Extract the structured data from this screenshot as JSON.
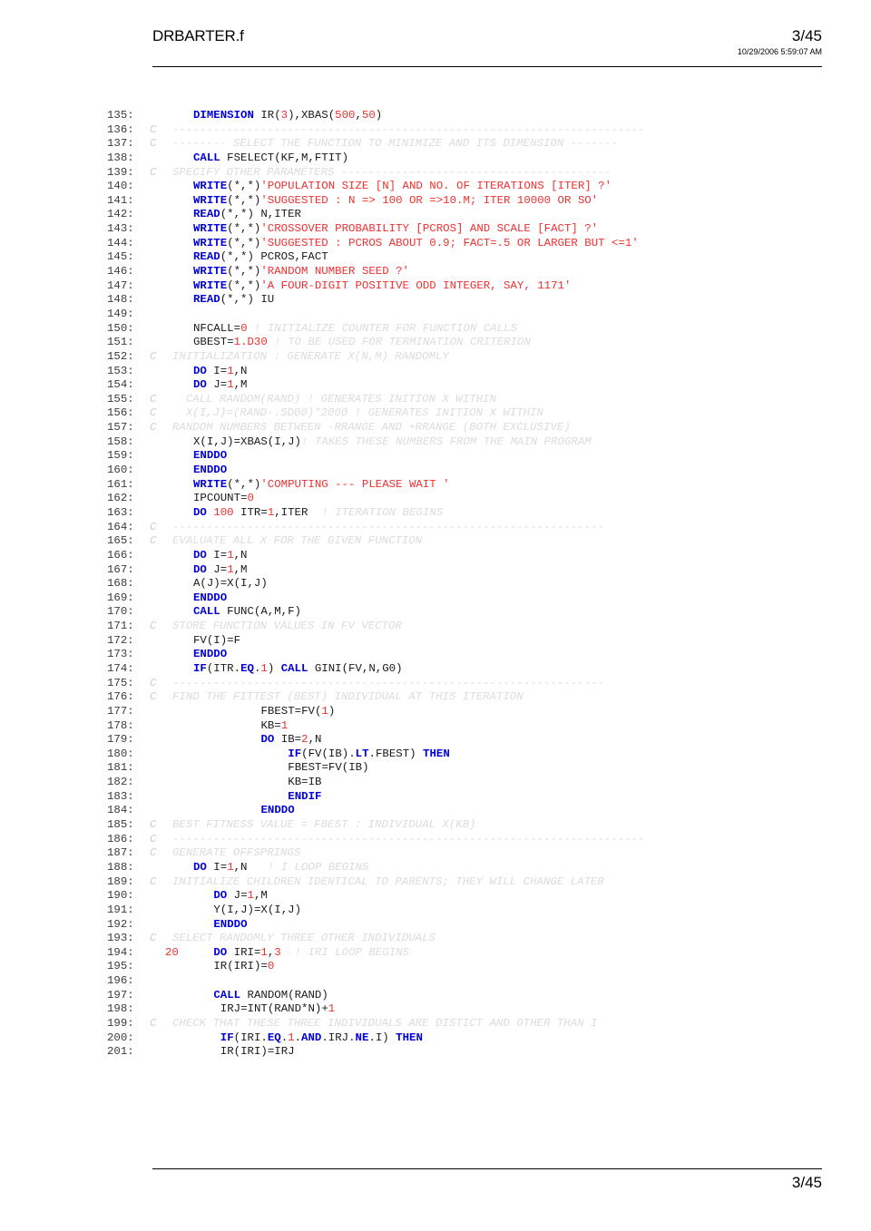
{
  "header": {
    "title": "DRBARTER.f",
    "page_number": "3/45",
    "timestamp": "10/29/2006 5:59:07 AM"
  },
  "footer": {
    "page_number": "3/45"
  },
  "listing": {
    "first_line": 135,
    "last_line": 201,
    "language": "Fortran",
    "lines": [
      {
        "n": "135:",
        "c": "",
        "indent": 0,
        "tokens": [
          {
            "t": "DIMENSION",
            "k": "kw"
          },
          {
            "t": " IR(",
            "k": "plain"
          },
          {
            "t": "3",
            "k": "num"
          },
          {
            "t": "),XBAS(",
            "k": "plain"
          },
          {
            "t": "500",
            "k": "num"
          },
          {
            "t": ",",
            "k": "plain"
          },
          {
            "t": "50",
            "k": "num"
          },
          {
            "t": ")",
            "k": "plain"
          }
        ]
      },
      {
        "n": "136:",
        "c": "C",
        "comment": true,
        "text": "----------------------------------------------------------------------"
      },
      {
        "n": "137:",
        "c": "C",
        "comment": true,
        "text": "-------- SELECT THE FUNCTION TO MINIMIZE AND ITS DIMENSION -------"
      },
      {
        "n": "138:",
        "c": "",
        "tokens": [
          {
            "t": "CALL",
            "k": "kw"
          },
          {
            "t": " FSELECT(KF,M,FTIT)",
            "k": "plain"
          }
        ]
      },
      {
        "n": "139:",
        "c": "C",
        "comment": true,
        "text": "SPECIFY OTHER PARAMETERS ----------------------------------------"
      },
      {
        "n": "140:",
        "c": "",
        "tokens": [
          {
            "t": "WRITE",
            "k": "kw"
          },
          {
            "t": "(*,*)",
            "k": "plain"
          },
          {
            "t": "'POPULATION SIZE [N] AND NO. OF ITERATIONS [ITER] ?'",
            "k": "str"
          }
        ]
      },
      {
        "n": "141:",
        "c": "",
        "tokens": [
          {
            "t": "WRITE",
            "k": "kw"
          },
          {
            "t": "(*,*)",
            "k": "plain"
          },
          {
            "t": "'SUGGESTED : N => 100 OR =>10.M; ITER 10000 OR SO'",
            "k": "str"
          }
        ]
      },
      {
        "n": "142:",
        "c": "",
        "tokens": [
          {
            "t": "READ",
            "k": "kw"
          },
          {
            "t": "(*,*) N,ITER",
            "k": "plain"
          }
        ]
      },
      {
        "n": "143:",
        "c": "",
        "tokens": [
          {
            "t": "WRITE",
            "k": "kw"
          },
          {
            "t": "(*,*)",
            "k": "plain"
          },
          {
            "t": "'CROSSOVER PROBABILITY [PCROS] AND SCALE [FACT] ?'",
            "k": "str"
          }
        ]
      },
      {
        "n": "144:",
        "c": "",
        "tokens": [
          {
            "t": "WRITE",
            "k": "kw"
          },
          {
            "t": "(*,*)",
            "k": "plain"
          },
          {
            "t": "'SUGGESTED : PCROS ABOUT 0.9; FACT=.5 OR LARGER BUT <=1'",
            "k": "str"
          }
        ]
      },
      {
        "n": "145:",
        "c": "",
        "tokens": [
          {
            "t": "READ",
            "k": "kw"
          },
          {
            "t": "(*,*) PCROS,FACT",
            "k": "plain"
          }
        ]
      },
      {
        "n": "146:",
        "c": "",
        "tokens": [
          {
            "t": "WRITE",
            "k": "kw"
          },
          {
            "t": "(*,*)",
            "k": "plain"
          },
          {
            "t": "'RANDOM NUMBER SEED ?'",
            "k": "str"
          }
        ]
      },
      {
        "n": "147:",
        "c": "",
        "tokens": [
          {
            "t": "WRITE",
            "k": "kw"
          },
          {
            "t": "(*,*)",
            "k": "plain"
          },
          {
            "t": "'A FOUR-DIGIT POSITIVE ODD INTEGER, SAY, 1171'",
            "k": "str"
          }
        ]
      },
      {
        "n": "148:",
        "c": "",
        "tokens": [
          {
            "t": "READ",
            "k": "kw"
          },
          {
            "t": "(*,*) IU",
            "k": "plain"
          }
        ]
      },
      {
        "n": "149:",
        "c": "",
        "tokens": []
      },
      {
        "n": "150:",
        "c": "",
        "tokens": [
          {
            "t": "NFCALL=",
            "k": "plain"
          },
          {
            "t": "0",
            "k": "num"
          },
          {
            "t": " ! INITIALIZE COUNTER FOR FUNCTION CALLS",
            "k": "cmt"
          }
        ]
      },
      {
        "n": "151:",
        "c": "",
        "tokens": [
          {
            "t": "GBEST=",
            "k": "plain"
          },
          {
            "t": "1.D30",
            "k": "num"
          },
          {
            "t": " ! TO BE USED FOR TERMINATION CRITERION",
            "k": "cmt"
          }
        ]
      },
      {
        "n": "152:",
        "c": "C",
        "comment": true,
        "text": "INITIALIZATION : GENERATE X(N,M) RANDOMLY"
      },
      {
        "n": "153:",
        "c": "",
        "tokens": [
          {
            "t": "DO",
            "k": "kw"
          },
          {
            "t": " I=",
            "k": "plain"
          },
          {
            "t": "1",
            "k": "num"
          },
          {
            "t": ",N",
            "k": "plain"
          }
        ]
      },
      {
        "n": "154:",
        "c": "",
        "tokens": [
          {
            "t": "DO",
            "k": "kw"
          },
          {
            "t": " J=",
            "k": "plain"
          },
          {
            "t": "1",
            "k": "num"
          },
          {
            "t": ",M",
            "k": "plain"
          }
        ]
      },
      {
        "n": "155:",
        "c": "C",
        "comment": true,
        "text": "  CALL RANDOM(RAND) ! GENERATES INITION X WITHIN"
      },
      {
        "n": "156:",
        "c": "C",
        "comment": true,
        "text": "  X(I,J)=(RAND-.5D00)*2000 ! GENERATES INITION X WITHIN"
      },
      {
        "n": "157:",
        "c": "C",
        "comment": true,
        "text": "RANDOM NUMBERS BETWEEN -RRANGE AND +RRANGE (BOTH EXCLUSIVE)"
      },
      {
        "n": "158:",
        "c": "",
        "tokens": [
          {
            "t": "X(I,J)=XBAS(I,J)",
            "k": "plain"
          },
          {
            "t": "! TAKES THESE NUMBERS FROM THE MAIN PROGRAM",
            "k": "cmt"
          }
        ]
      },
      {
        "n": "159:",
        "c": "",
        "tokens": [
          {
            "t": "ENDDO",
            "k": "kw"
          }
        ]
      },
      {
        "n": "160:",
        "c": "",
        "tokens": [
          {
            "t": "ENDDO",
            "k": "kw"
          }
        ]
      },
      {
        "n": "161:",
        "c": "",
        "tokens": [
          {
            "t": "WRITE",
            "k": "kw"
          },
          {
            "t": "(*,*)",
            "k": "plain"
          },
          {
            "t": "'COMPUTING --- PLEASE WAIT '",
            "k": "str"
          }
        ]
      },
      {
        "n": "162:",
        "c": "",
        "tokens": [
          {
            "t": "IPCOUNT=",
            "k": "plain"
          },
          {
            "t": "0",
            "k": "num"
          }
        ]
      },
      {
        "n": "163:",
        "c": "",
        "tokens": [
          {
            "t": "DO",
            "k": "kw"
          },
          {
            "t": " ",
            "k": "plain"
          },
          {
            "t": "100",
            "k": "num"
          },
          {
            "t": " ITR=",
            "k": "plain"
          },
          {
            "t": "1",
            "k": "num"
          },
          {
            "t": ",ITER",
            "k": "plain"
          },
          {
            "t": "  ! ITERATION BEGINS",
            "k": "cmt"
          }
        ]
      },
      {
        "n": "164:",
        "c": "C",
        "comment": true,
        "text": "----------------------------------------------------------------"
      },
      {
        "n": "165:",
        "c": "C",
        "comment": true,
        "text": "EVALUATE ALL X FOR THE GIVEN FUNCTION"
      },
      {
        "n": "166:",
        "c": "",
        "tokens": [
          {
            "t": "DO",
            "k": "kw"
          },
          {
            "t": " I=",
            "k": "plain"
          },
          {
            "t": "1",
            "k": "num"
          },
          {
            "t": ",N",
            "k": "plain"
          }
        ]
      },
      {
        "n": "167:",
        "c": "",
        "tokens": [
          {
            "t": "DO",
            "k": "kw"
          },
          {
            "t": " J=",
            "k": "plain"
          },
          {
            "t": "1",
            "k": "num"
          },
          {
            "t": ",M",
            "k": "plain"
          }
        ]
      },
      {
        "n": "168:",
        "c": "",
        "tokens": [
          {
            "t": "A(J)=X(I,J)",
            "k": "plain"
          }
        ]
      },
      {
        "n": "169:",
        "c": "",
        "tokens": [
          {
            "t": "ENDDO",
            "k": "kw"
          }
        ]
      },
      {
        "n": "170:",
        "c": "",
        "tokens": [
          {
            "t": "CALL",
            "k": "kw"
          },
          {
            "t": " FUNC(A,M,F)",
            "k": "plain"
          }
        ]
      },
      {
        "n": "171:",
        "c": "C",
        "comment": true,
        "text": "STORE FUNCTION VALUES IN FV VECTOR"
      },
      {
        "n": "172:",
        "c": "",
        "tokens": [
          {
            "t": "FV(I)=F",
            "k": "plain"
          }
        ]
      },
      {
        "n": "173:",
        "c": "",
        "tokens": [
          {
            "t": "ENDDO",
            "k": "kw"
          }
        ]
      },
      {
        "n": "174:",
        "c": "",
        "tokens": [
          {
            "t": "IF",
            "k": "kw"
          },
          {
            "t": "(ITR.",
            "k": "plain"
          },
          {
            "t": "EQ",
            "k": "kw"
          },
          {
            "t": ".",
            "k": "plain"
          },
          {
            "t": "1",
            "k": "num"
          },
          {
            "t": ") ",
            "k": "plain"
          },
          {
            "t": "CALL",
            "k": "kw"
          },
          {
            "t": " GINI(FV,N,G0)",
            "k": "plain"
          }
        ]
      },
      {
        "n": "175:",
        "c": "C",
        "comment": true,
        "text": "----------------------------------------------------------------"
      },
      {
        "n": "176:",
        "c": "C",
        "comment": true,
        "text": "FIND THE FITTEST (BEST) INDIVIDUAL AT THIS ITERATION"
      },
      {
        "n": "177:",
        "c": "",
        "pad": 10,
        "tokens": [
          {
            "t": "FBEST=FV(",
            "k": "plain"
          },
          {
            "t": "1",
            "k": "num"
          },
          {
            "t": ")",
            "k": "plain"
          }
        ]
      },
      {
        "n": "178:",
        "c": "",
        "pad": 10,
        "tokens": [
          {
            "t": "KB=",
            "k": "plain"
          },
          {
            "t": "1",
            "k": "num"
          }
        ]
      },
      {
        "n": "179:",
        "c": "",
        "pad": 10,
        "tokens": [
          {
            "t": "DO",
            "k": "kw"
          },
          {
            "t": " IB=",
            "k": "plain"
          },
          {
            "t": "2",
            "k": "num"
          },
          {
            "t": ",N",
            "k": "plain"
          }
        ]
      },
      {
        "n": "180:",
        "c": "",
        "pad": 14,
        "tokens": [
          {
            "t": "IF",
            "k": "kw"
          },
          {
            "t": "(FV(IB).",
            "k": "plain"
          },
          {
            "t": "LT",
            "k": "kw"
          },
          {
            "t": ".FBEST) ",
            "k": "plain"
          },
          {
            "t": "THEN",
            "k": "kw"
          }
        ]
      },
      {
        "n": "181:",
        "c": "",
        "pad": 14,
        "tokens": [
          {
            "t": "FBEST=FV(IB)",
            "k": "plain"
          }
        ]
      },
      {
        "n": "182:",
        "c": "",
        "pad": 14,
        "tokens": [
          {
            "t": "KB=IB",
            "k": "plain"
          }
        ]
      },
      {
        "n": "183:",
        "c": "",
        "pad": 14,
        "tokens": [
          {
            "t": "ENDIF",
            "k": "kw"
          }
        ]
      },
      {
        "n": "184:",
        "c": "",
        "pad": 10,
        "tokens": [
          {
            "t": "ENDDO",
            "k": "kw"
          }
        ]
      },
      {
        "n": "185:",
        "c": "C",
        "comment": true,
        "text": "BEST FITNESS VALUE = FBEST : INDIVIDUAL X(KB)"
      },
      {
        "n": "186:",
        "c": "C",
        "comment": true,
        "text": "----------------------------------------------------------------------"
      },
      {
        "n": "187:",
        "c": "C",
        "comment": true,
        "text": "GENERATE OFFSPRINGS"
      },
      {
        "n": "188:",
        "c": "",
        "tokens": [
          {
            "t": "DO",
            "k": "kw"
          },
          {
            "t": " I=",
            "k": "plain"
          },
          {
            "t": "1",
            "k": "num"
          },
          {
            "t": ",N",
            "k": "plain"
          },
          {
            "t": "   ! I LOOP BEGINS",
            "k": "cmt"
          }
        ]
      },
      {
        "n": "189:",
        "c": "C",
        "comment": true,
        "text": "INITIALIZE CHILDREN IDENTICAL TO PARENTS; THEY WILL CHANGE LATER"
      },
      {
        "n": "190:",
        "c": "",
        "pad": 3,
        "tokens": [
          {
            "t": "DO",
            "k": "kw"
          },
          {
            "t": " J=",
            "k": "plain"
          },
          {
            "t": "1",
            "k": "num"
          },
          {
            "t": ",M",
            "k": "plain"
          }
        ]
      },
      {
        "n": "191:",
        "c": "",
        "pad": 3,
        "tokens": [
          {
            "t": "Y(I,J)=X(I,J)",
            "k": "plain"
          }
        ]
      },
      {
        "n": "192:",
        "c": "",
        "pad": 3,
        "tokens": [
          {
            "t": "ENDDO",
            "k": "kw"
          }
        ]
      },
      {
        "n": "193:",
        "c": "C",
        "comment": true,
        "text": "SELECT RANDOMLY THREE OTHER INDIVIDUALS"
      },
      {
        "n": "194:",
        "c": "",
        "label": "20",
        "pad": 3,
        "tokens": [
          {
            "t": "DO",
            "k": "kw"
          },
          {
            "t": " IRI=",
            "k": "plain"
          },
          {
            "t": "1",
            "k": "num"
          },
          {
            "t": ",",
            "k": "plain"
          },
          {
            "t": "3",
            "k": "num"
          },
          {
            "t": "  ! IRI LOOP BEGINS",
            "k": "cmt"
          }
        ]
      },
      {
        "n": "195:",
        "c": "",
        "pad": 3,
        "tokens": [
          {
            "t": "IR(IRI)=",
            "k": "plain"
          },
          {
            "t": "0",
            "k": "num"
          }
        ]
      },
      {
        "n": "196:",
        "c": "",
        "tokens": []
      },
      {
        "n": "197:",
        "c": "",
        "pad": 3,
        "tokens": [
          {
            "t": "CALL",
            "k": "kw"
          },
          {
            "t": " RANDOM(RAND)",
            "k": "plain"
          }
        ]
      },
      {
        "n": "198:",
        "c": "",
        "pad": 4,
        "tokens": [
          {
            "t": "IRJ=INT(RAND*N)+",
            "k": "plain"
          },
          {
            "t": "1",
            "k": "num"
          }
        ]
      },
      {
        "n": "199:",
        "c": "C",
        "comment": true,
        "text": "CHECK THAT THESE THREE INDIVIDUALS ARE DISTICT AND OTHER THAN I"
      },
      {
        "n": "200:",
        "c": "",
        "pad": 4,
        "tokens": [
          {
            "t": "IF",
            "k": "kw"
          },
          {
            "t": "(IRI.",
            "k": "plain"
          },
          {
            "t": "EQ",
            "k": "kw"
          },
          {
            "t": ".",
            "k": "plain"
          },
          {
            "t": "1",
            "k": "num"
          },
          {
            "t": ".",
            "k": "plain"
          },
          {
            "t": "AND",
            "k": "kw"
          },
          {
            "t": ".IRJ.",
            "k": "plain"
          },
          {
            "t": "NE",
            "k": "kw"
          },
          {
            "t": ".I) ",
            "k": "plain"
          },
          {
            "t": "THEN",
            "k": "kw"
          }
        ]
      },
      {
        "n": "201:",
        "c": "",
        "pad": 4,
        "tokens": [
          {
            "t": "IR(IRI)=IRJ",
            "k": "plain"
          }
        ]
      }
    ]
  },
  "colors": {
    "keyword": "#0000d8",
    "string": "#f03030",
    "number": "#f03030",
    "comment": "#dcdcdc",
    "lineno": "#3c3c3c",
    "code": "#1a1a1a",
    "page_background": "#ffffff",
    "rule": "#000000"
  }
}
